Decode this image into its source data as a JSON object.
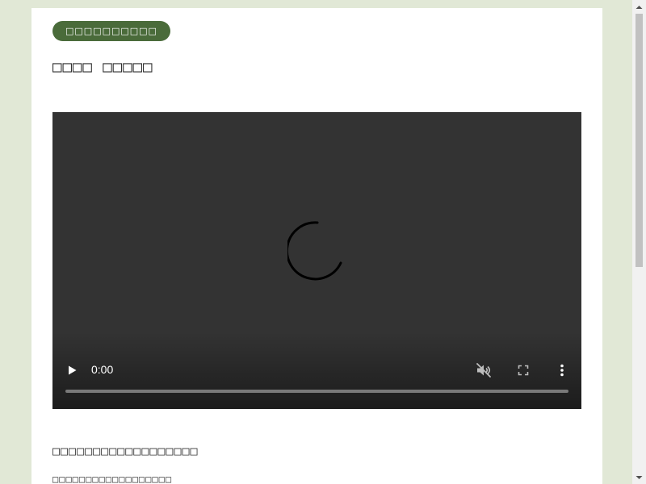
{
  "page": {
    "badge_label": "□□□□□□□□□□",
    "title": "□□□□ □□□□□",
    "section_heading": "□□□□□□□□□□□□□□□□□□",
    "section_sub": "□□□□□□□□□□□□□□□□□□"
  },
  "video": {
    "state": "loading",
    "current_time": "0:00",
    "progress_fraction": 0,
    "muted": true,
    "icons": {
      "play": "play-icon",
      "mute": "volume-off-icon",
      "fullscreen": "fullscreen-icon",
      "more": "more-vertical-icon",
      "spinner": "loading-spinner-icon"
    }
  },
  "colors": {
    "page_background": "#e1e8d6",
    "badge_background": "#4a6b3a",
    "player_background": "#333333"
  }
}
